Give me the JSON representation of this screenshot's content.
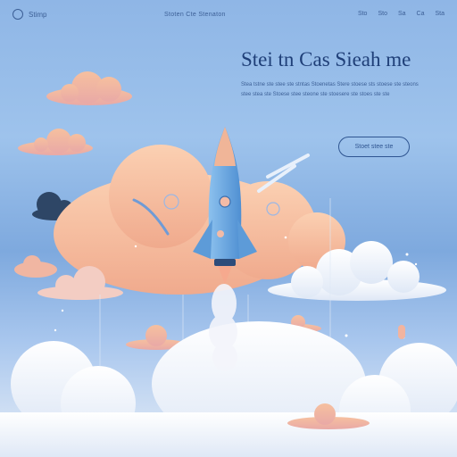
{
  "nav": {
    "logo_text": "Stimp",
    "center_text": "Stoten  Cte  Stenaton",
    "items": [
      "Sto",
      "Sto",
      "Sa",
      "Ca",
      "Sta"
    ]
  },
  "hero": {
    "headline": "Stei tn Cas Sieah me",
    "subtext": "Stea tstne ste stee ste stntas Stoenetas Stere stoese sts stoese ste steons stee stea ste Stoese stee steone ste stoesere ste stoes ste ste",
    "cta_label": "Stoet stee ste"
  },
  "colors": {
    "sky_top": "#8fb6e6",
    "rocket_body": "#6aa7e0",
    "cloud_peach": "#f4b996",
    "text_dark": "#1f3f78"
  }
}
